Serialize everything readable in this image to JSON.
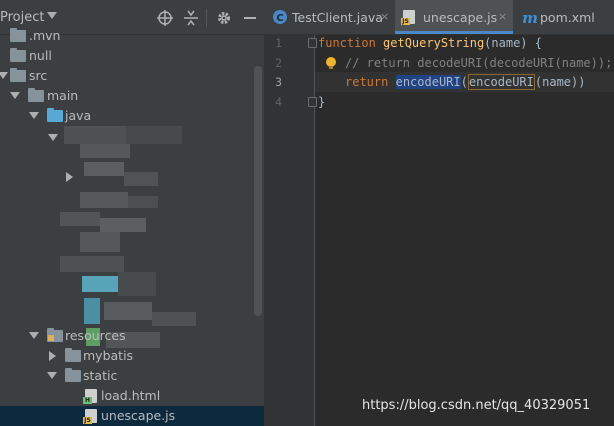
{
  "project_panel": {
    "title": "Project",
    "header_icons": [
      "target-icon",
      "collapse-icon",
      "gear-icon",
      "minimize-icon"
    ],
    "tree": [
      {
        "label": ".mvn",
        "kind": "folder",
        "expanded": false
      },
      {
        "label": "null",
        "kind": "folder",
        "expanded": false
      },
      {
        "label": "src",
        "kind": "folder",
        "expanded": true
      },
      {
        "label": "main",
        "kind": "folder",
        "expanded": true
      },
      {
        "label": "java",
        "kind": "source-folder",
        "expanded": true
      },
      {
        "label": "resources",
        "kind": "resources-folder",
        "expanded": true
      },
      {
        "label": "mybatis",
        "kind": "folder",
        "expanded": false
      },
      {
        "label": "static",
        "kind": "folder",
        "expanded": true
      },
      {
        "label": "load.html",
        "kind": "html-file"
      },
      {
        "label": "unescape.js",
        "kind": "js-file",
        "selected": true
      }
    ]
  },
  "editor": {
    "tabs": [
      {
        "label": "TestClient.java",
        "icon": "java-class-icon",
        "active": false,
        "close": "×"
      },
      {
        "label": "unescape.js",
        "icon": "js-file-icon",
        "active": true,
        "close": "×"
      },
      {
        "label": "pom.xml",
        "icon": "maven-icon",
        "active": false
      }
    ],
    "line_numbers": [
      "1",
      "2",
      "3",
      "4"
    ],
    "current_line": 3,
    "code": {
      "line1": {
        "kw": "function",
        "name": " getQueryString",
        "rest": "(name) {"
      },
      "line2": {
        "comment": "// return decodeURI(decodeURI(name));"
      },
      "line3": {
        "kw": "return",
        "sp": " ",
        "highlight": "encodeURI",
        "mid": "(",
        "match": "encodeURI",
        "rest": "(name))"
      },
      "line4": {
        "text": "}"
      }
    }
  },
  "watermark": "https://blog.csdn.net/qq_40329051",
  "colors": {
    "panel_bg": "#3c3f41",
    "editor_bg": "#2b2b2b",
    "keyword": "#cc7832",
    "function_name": "#ffc66d",
    "comment": "#808080",
    "selection": "#214283",
    "active_tab_underline": "#4a88c7"
  }
}
